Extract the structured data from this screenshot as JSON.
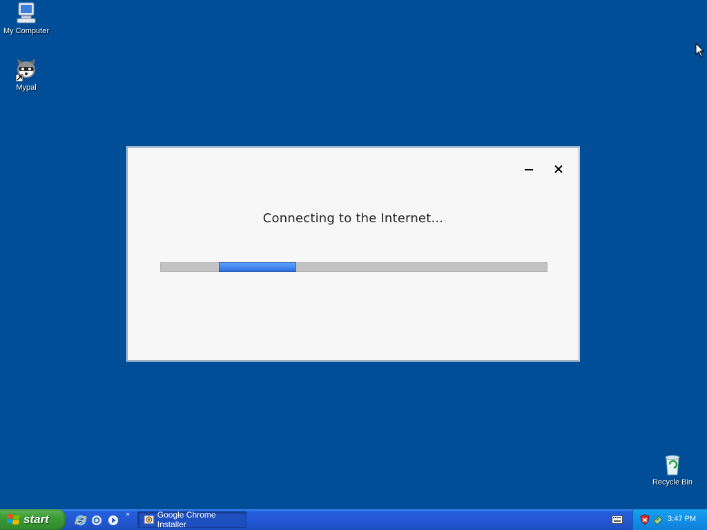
{
  "desktop": {
    "icons": [
      {
        "label": "My Computer",
        "icon": "my-computer-icon"
      },
      {
        "label": "Mypal",
        "icon": "mypal-raccoon-icon"
      },
      {
        "label": "Recycle Bin",
        "icon": "recycle-bin-icon"
      }
    ],
    "background_color": "#004e98"
  },
  "installer": {
    "status": "Connecting to the Internet...",
    "progress": {
      "mode": "indeterminate",
      "segment_start_fraction": 0.15,
      "segment_length_fraction": 0.2
    },
    "minimize_icon": "minimize-icon",
    "close_icon": "close-icon"
  },
  "taskbar": {
    "start_label": "start",
    "quick_launch": [
      "internet-explorer-icon",
      "browser-icon",
      "media-player-icon"
    ],
    "quick_launch_more": "»",
    "tasks": [
      {
        "label": "Google Chrome Installer",
        "icon": "chrome-installer-icon"
      }
    ],
    "tray": {
      "time": "3:47 PM",
      "icons": [
        "keyboard-icon",
        "security-shield-icon",
        "network-icon"
      ]
    }
  }
}
